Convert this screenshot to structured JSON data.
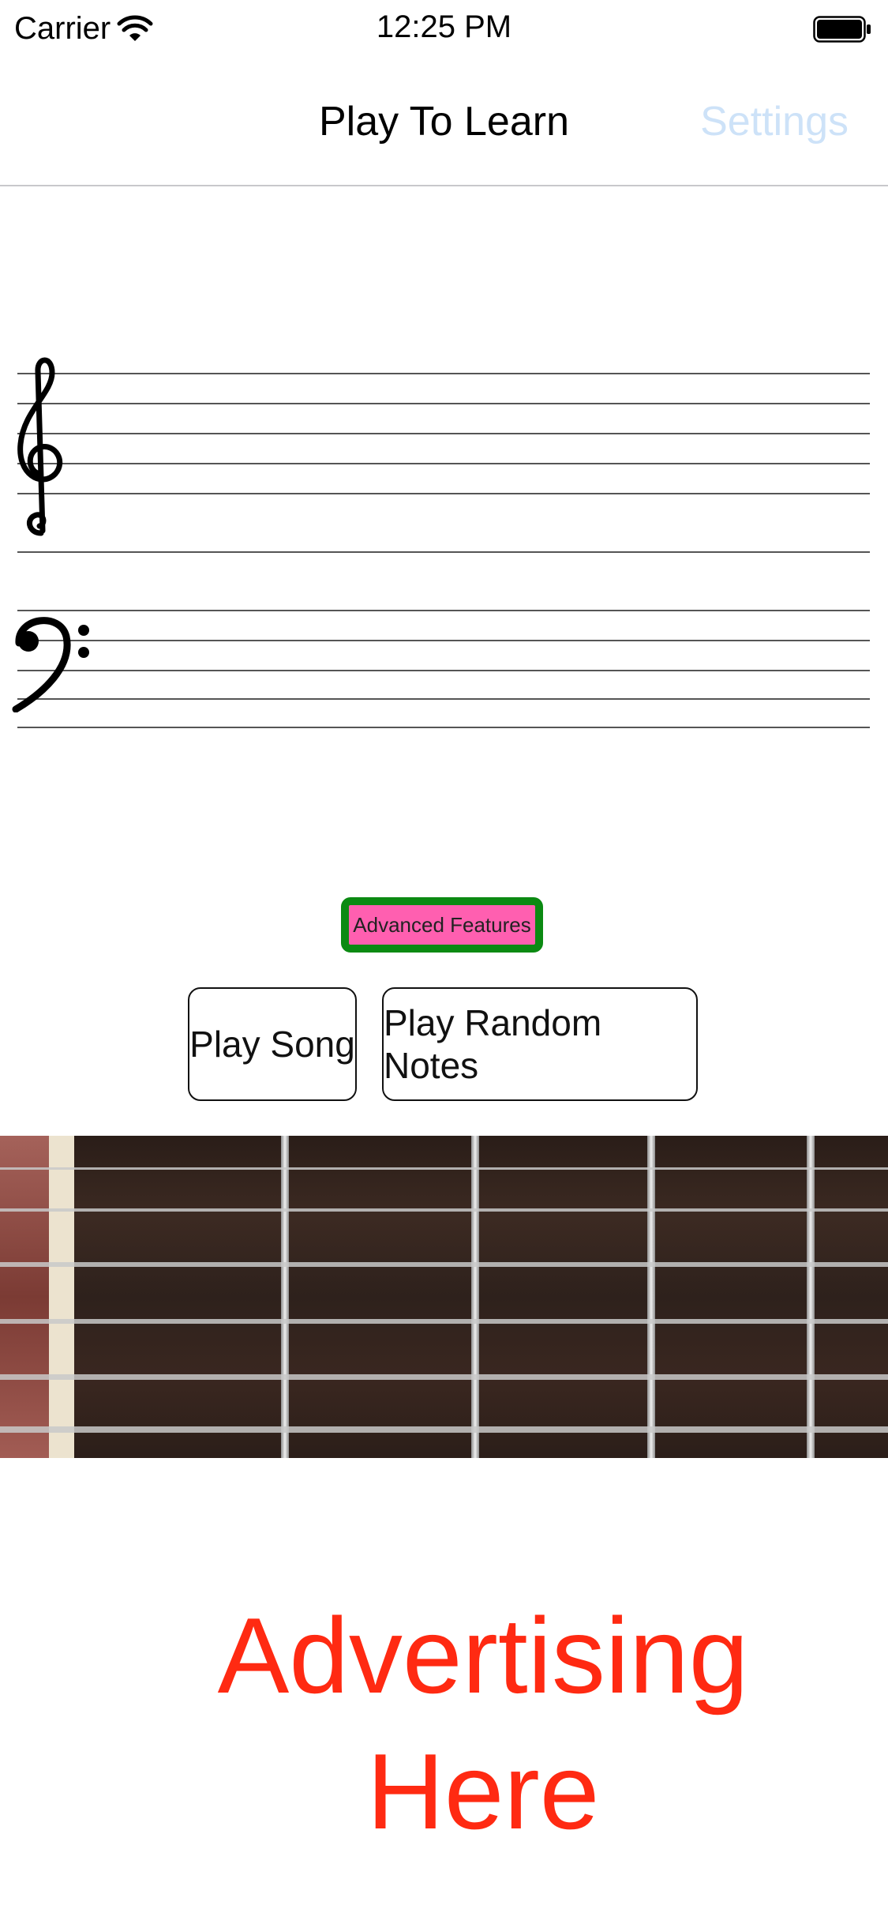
{
  "status_bar": {
    "carrier": "Carrier",
    "time": "12:25 PM",
    "wifi_icon": "wifi-icon",
    "battery_icon": "battery-icon"
  },
  "nav": {
    "title": "Play To Learn",
    "settings": "Settings",
    "settings_color": "#cde2f8"
  },
  "staff": {
    "treble_icon": "treble-clef-icon",
    "bass_icon": "bass-clef-icon"
  },
  "advanced": {
    "label": "Advanced Features",
    "border_color": "#0b8a12",
    "fill_color": "#ff5fb0"
  },
  "buttons": {
    "play_song": "Play Song",
    "play_random": "Play Random Notes"
  },
  "ad": {
    "line1": "Advertising",
    "line2": "Here",
    "color": "#ff2a12"
  }
}
